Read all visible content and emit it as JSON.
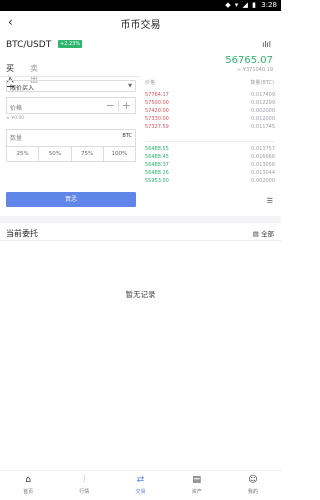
{
  "status": {
    "time": "3:28",
    "icons": "◆ ▾ ◢ ▮"
  },
  "header": {
    "back": "‹",
    "title": "币币交易"
  },
  "pair": {
    "name": "BTC/USDT",
    "change": "+2.23%",
    "chart_icon": "candle-chart-icon"
  },
  "price": {
    "last": "56765.07",
    "approx": "≈ ¥371040.19"
  },
  "tabs": [
    {
      "label": "买入"
    },
    {
      "label": "卖出"
    }
  ],
  "form": {
    "order_type": "限价买入",
    "price_placeholder": "价格",
    "approx": "≈ ¥0.00",
    "qty_label": "数量",
    "qty_unit": "BTC",
    "percents": [
      "25%",
      "50%",
      "75%",
      "100%"
    ],
    "submit": "買孞"
  },
  "orderbook": {
    "header_price": "价格",
    "header_qty": "数量(BTC)",
    "asks": [
      {
        "price": "57764.17",
        "qty": "0.017409"
      },
      {
        "price": "57500.00",
        "qty": "0.012299"
      },
      {
        "price": "57420.00",
        "qty": "0.002000"
      },
      {
        "price": "57330.00",
        "qty": "0.012000"
      },
      {
        "price": "57327.59",
        "qty": "0.011745"
      }
    ],
    "bids": [
      {
        "price": "56488.55",
        "qty": "0.013757"
      },
      {
        "price": "56488.45",
        "qty": "0.016666"
      },
      {
        "price": "56488.37",
        "qty": "0.013056"
      },
      {
        "price": "56488.26",
        "qty": "0.013044"
      },
      {
        "price": "55953.00",
        "qty": "0.002000"
      }
    ]
  },
  "orders": {
    "title": "当前委托",
    "all": "全部",
    "empty": "暂无记录"
  },
  "nav": [
    {
      "label": "首页",
      "icon": "⌂"
    },
    {
      "label": "行情",
      "icon": "⫶"
    },
    {
      "label": "交易",
      "icon": "⇄"
    },
    {
      "label": "资产",
      "icon": "▤"
    },
    {
      "label": "我的",
      "icon": "☺"
    }
  ],
  "colors": {
    "up": "#2fb56e",
    "down": "#e2505a",
    "accent": "#5f86e8"
  }
}
